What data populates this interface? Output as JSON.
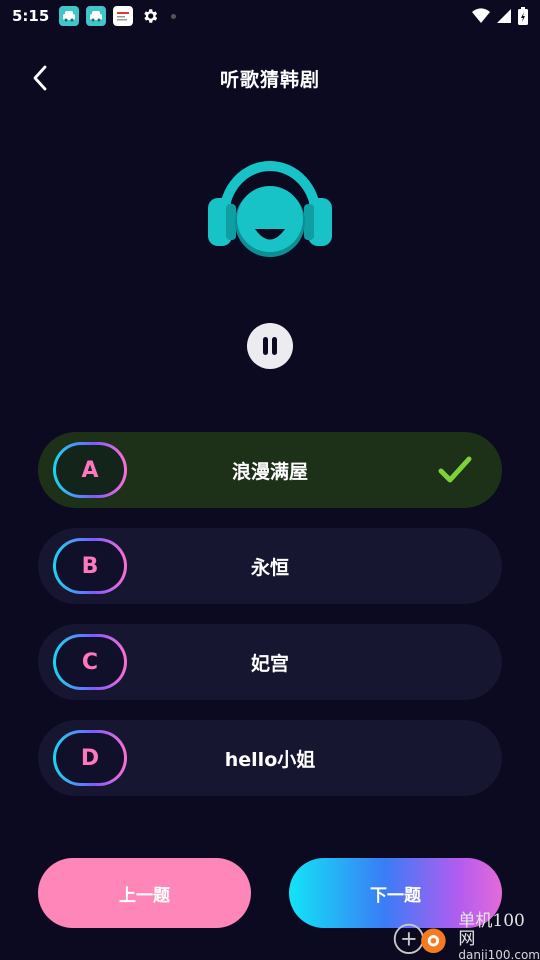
{
  "status_bar": {
    "time": "5:15"
  },
  "header": {
    "title": "听歌猜韩剧"
  },
  "options": [
    {
      "letter": "A",
      "text": "浪漫满屋",
      "correct": true
    },
    {
      "letter": "B",
      "text": "永恒",
      "correct": false
    },
    {
      "letter": "C",
      "text": "妃宫",
      "correct": false
    },
    {
      "letter": "D",
      "text": "hello小姐",
      "correct": false
    }
  ],
  "footer": {
    "prev_label": "上一题",
    "next_label": "下一题"
  },
  "watermark": {
    "title": "单机100网",
    "url": "danji100.com"
  },
  "colors": {
    "background": "#0b0a20",
    "option_bg": "#161630",
    "correct_bg": "#1c3118",
    "letter": "#ff78be",
    "check": "#7bd23a",
    "mascot": "#17c3c6",
    "prev_button": "#ff86b8"
  },
  "icons": {
    "back": "chevron-left-icon",
    "pause": "pause-icon",
    "correct": "check-icon",
    "mascot": "headphone-mascot-icon"
  }
}
